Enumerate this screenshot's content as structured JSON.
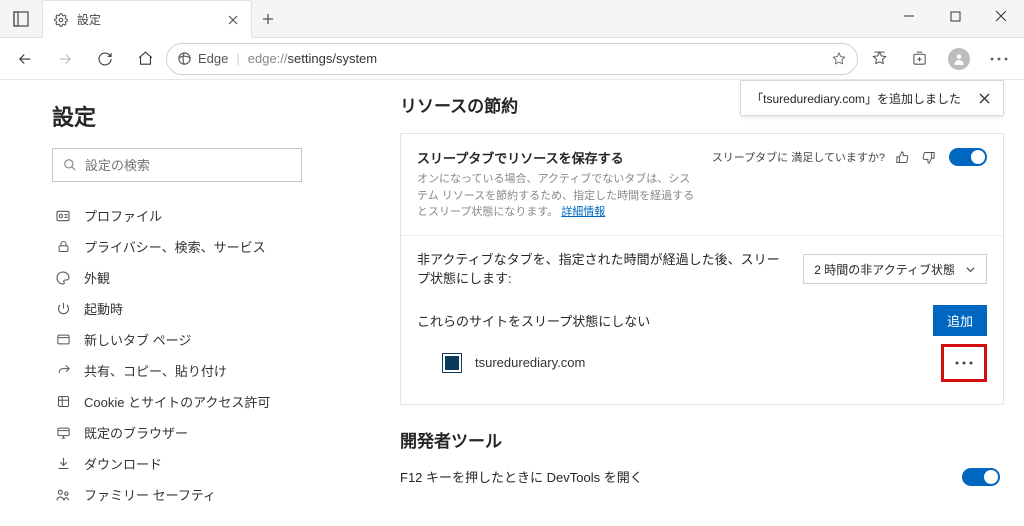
{
  "titlebar": {
    "tab_label": "設定"
  },
  "addressbar": {
    "edge_label": "Edge",
    "url_prefix": "edge://",
    "url_path": "settings/system"
  },
  "sidebar": {
    "heading": "設定",
    "search_placeholder": "設定の検索",
    "items": [
      {
        "label": "プロファイル"
      },
      {
        "label": "プライバシー、検索、サービス"
      },
      {
        "label": "外観"
      },
      {
        "label": "起動時"
      },
      {
        "label": "新しいタブ ページ"
      },
      {
        "label": "共有、コピー、貼り付け"
      },
      {
        "label": "Cookie とサイトのアクセス許可"
      },
      {
        "label": "既定のブラウザー"
      },
      {
        "label": "ダウンロード"
      },
      {
        "label": "ファミリー セーフティ"
      }
    ]
  },
  "notice": {
    "text": "「tsuredurediary.com」を追加しました"
  },
  "main": {
    "section_title": "リソースの節約",
    "sleep": {
      "title": "スリープタブでリソースを保存する",
      "desc": "オンになっている場合、アクティブでないタブは、システム リソースを節約するため、指定した時間を経過するとスリープ状態になります。",
      "more": "詳細情報",
      "feedback_q": "スリープタブに 満足していますか?"
    },
    "inactivity": {
      "label": "非アクティブなタブを、指定された時間が経過した後、スリープ状態にします:",
      "select_value": "2 時間の非アクティブ状態"
    },
    "exclude": {
      "label": "これらのサイトをスリープ状態にしない",
      "add": "追加",
      "site": "tsuredurediary.com"
    },
    "dev_title": "開発者ツール",
    "dev_f12": "F12 キーを押したときに DevTools を開く"
  }
}
